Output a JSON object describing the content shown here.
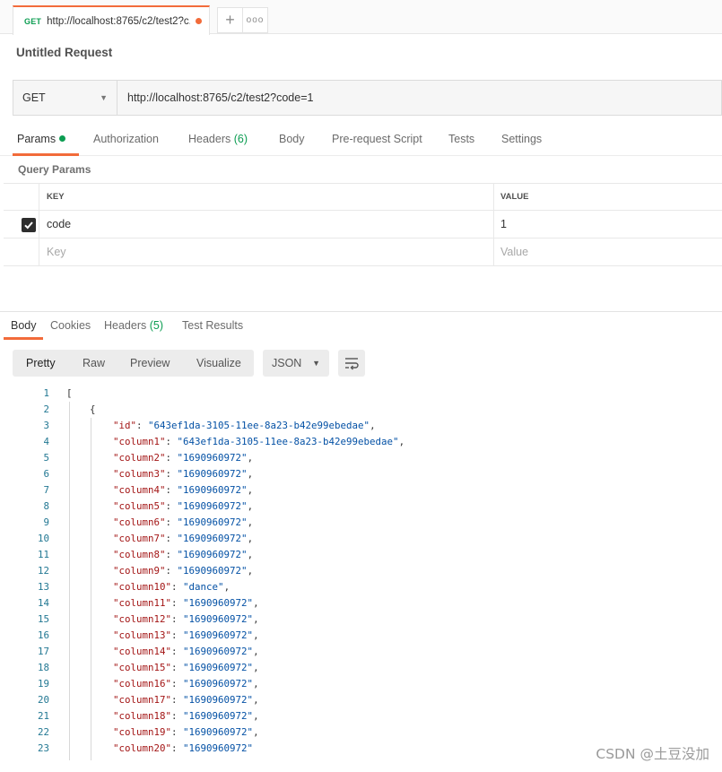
{
  "tab": {
    "method": "GET",
    "title": "http://localhost:8765/c2/test2?c...",
    "plus_label": "+",
    "more_label": "ooo"
  },
  "request": {
    "name": "Untitled Request",
    "method": "GET",
    "url": "http://localhost:8765/c2/test2?code=1"
  },
  "request_tabs": [
    {
      "label": "Params"
    },
    {
      "label": "Authorization"
    },
    {
      "label": "Headers",
      "count": "(6)"
    },
    {
      "label": "Body"
    },
    {
      "label": "Pre-request Script"
    },
    {
      "label": "Tests"
    },
    {
      "label": "Settings"
    }
  ],
  "query_params": {
    "section_label": "Query Params",
    "headers": {
      "key": "KEY",
      "value": "VALUE"
    },
    "rows": [
      {
        "checked": true,
        "key": "code",
        "value": "1"
      }
    ],
    "placeholder": {
      "key": "Key",
      "value": "Value"
    }
  },
  "response_tabs": [
    {
      "label": "Body"
    },
    {
      "label": "Cookies"
    },
    {
      "label": "Headers",
      "count": "(5)"
    },
    {
      "label": "Test Results"
    }
  ],
  "response_view": {
    "modes": [
      "Pretty",
      "Raw",
      "Preview",
      "Visualize"
    ],
    "active": "Pretty",
    "format": "JSON"
  },
  "code_lines": [
    {
      "n": "1",
      "text": "["
    },
    {
      "n": "2",
      "text": "    {"
    },
    {
      "n": "3",
      "key": "\"id\"",
      "value": "\"643ef1da-3105-11ee-8a23-b42e99ebedae\"",
      "end": ","
    },
    {
      "n": "4",
      "key": "\"column1\"",
      "value": "\"643ef1da-3105-11ee-8a23-b42e99ebedae\"",
      "end": ","
    },
    {
      "n": "5",
      "key": "\"column2\"",
      "value": "\"1690960972\"",
      "end": ","
    },
    {
      "n": "6",
      "key": "\"column3\"",
      "value": "\"1690960972\"",
      "end": ","
    },
    {
      "n": "7",
      "key": "\"column4\"",
      "value": "\"1690960972\"",
      "end": ","
    },
    {
      "n": "8",
      "key": "\"column5\"",
      "value": "\"1690960972\"",
      "end": ","
    },
    {
      "n": "9",
      "key": "\"column6\"",
      "value": "\"1690960972\"",
      "end": ","
    },
    {
      "n": "10",
      "key": "\"column7\"",
      "value": "\"1690960972\"",
      "end": ","
    },
    {
      "n": "11",
      "key": "\"column8\"",
      "value": "\"1690960972\"",
      "end": ","
    },
    {
      "n": "12",
      "key": "\"column9\"",
      "value": "\"1690960972\"",
      "end": ","
    },
    {
      "n": "13",
      "key": "\"column10\"",
      "value": "\"dance\"",
      "end": ","
    },
    {
      "n": "14",
      "key": "\"column11\"",
      "value": "\"1690960972\"",
      "end": ","
    },
    {
      "n": "15",
      "key": "\"column12\"",
      "value": "\"1690960972\"",
      "end": ","
    },
    {
      "n": "16",
      "key": "\"column13\"",
      "value": "\"1690960972\"",
      "end": ","
    },
    {
      "n": "17",
      "key": "\"column14\"",
      "value": "\"1690960972\"",
      "end": ","
    },
    {
      "n": "18",
      "key": "\"column15\"",
      "value": "\"1690960972\"",
      "end": ","
    },
    {
      "n": "19",
      "key": "\"column16\"",
      "value": "\"1690960972\"",
      "end": ","
    },
    {
      "n": "20",
      "key": "\"column17\"",
      "value": "\"1690960972\"",
      "end": ","
    },
    {
      "n": "21",
      "key": "\"column18\"",
      "value": "\"1690960972\"",
      "end": ","
    },
    {
      "n": "22",
      "key": "\"column19\"",
      "value": "\"1690960972\"",
      "end": ","
    },
    {
      "n": "23",
      "key": "\"column20\"",
      "value": "\"1690960972\"",
      "end": ""
    }
  ],
  "watermark": "CSDN @土豆没加",
  "colors": {
    "accent": "#f26b3a",
    "method_get": "#0c9d52",
    "json_key": "#a31515",
    "json_string": "#0451a5",
    "line_number": "#237893"
  }
}
